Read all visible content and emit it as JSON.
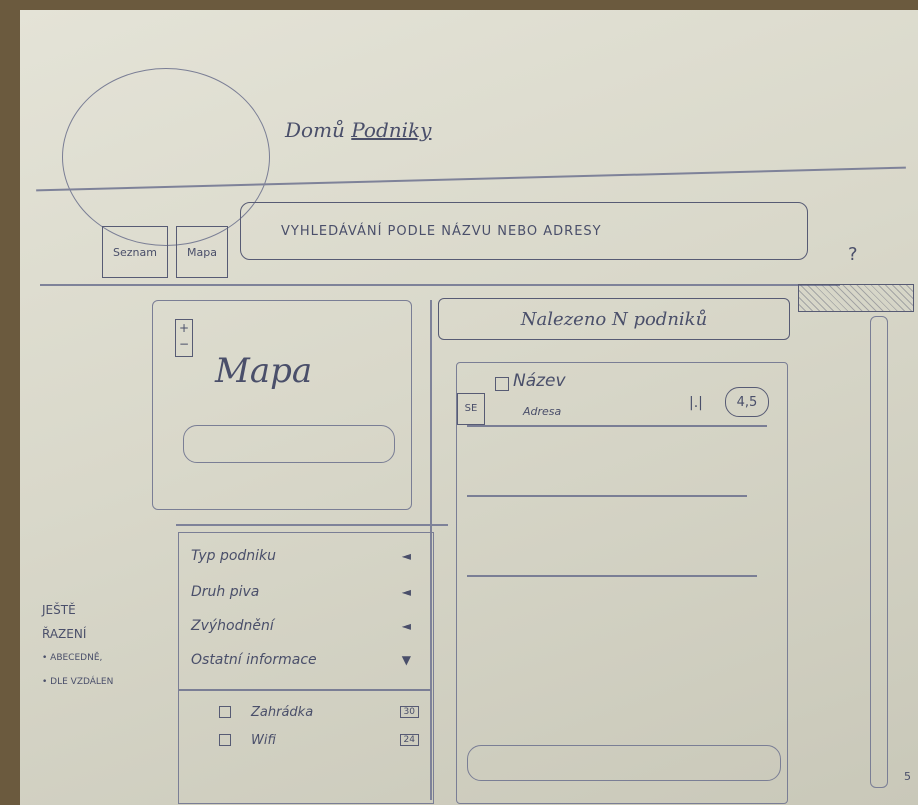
{
  "header": {
    "brand_prefix": "Domů",
    "brand_name": "Podniky"
  },
  "toolbar": {
    "btn1_label": "Seznam",
    "btn2_label": "Mapa",
    "search_placeholder": "VYHLEDÁVÁNÍ PODLE NÁZVU NEBO ADRESY",
    "question": "?"
  },
  "map": {
    "label": "Mapa",
    "zoom": "+ −"
  },
  "results": {
    "found_text": "Nalezeno N podniků",
    "item": {
      "icon": "SE",
      "name": "Název",
      "address": "Adresa",
      "bars": "|.|",
      "rating": "4,5"
    }
  },
  "filters": {
    "items": [
      {
        "label": "Typ podniku",
        "arrow": "◄"
      },
      {
        "label": "Druh piva",
        "arrow": "◄"
      },
      {
        "label": "Zvýhodnění",
        "arrow": "◄"
      },
      {
        "label": "Ostatní informace",
        "arrow": "▼"
      }
    ],
    "sub_items": [
      {
        "label": "Zahrádka",
        "count": "30"
      },
      {
        "label": "Wifi",
        "count": "24"
      }
    ]
  },
  "side_note": {
    "line1": "Ještě",
    "line2": "řazení",
    "line3": "• abecedně,",
    "line4": "• dle vzdálen"
  },
  "corner_text": "5"
}
